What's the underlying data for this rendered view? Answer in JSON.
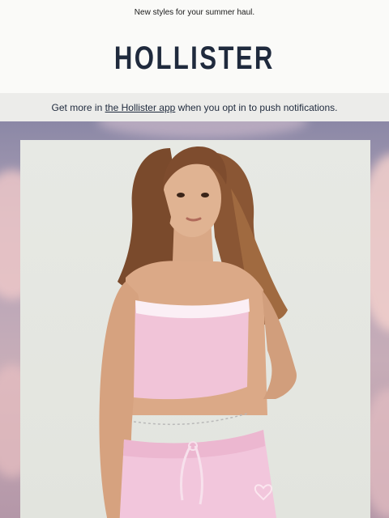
{
  "preheader": {
    "text": "New styles for your summer haul."
  },
  "brand": {
    "logo_text": "HOLLISTER"
  },
  "promo": {
    "prefix": "Get more in ",
    "link_text": "the Hollister app",
    "suffix": " when you opt in to push notifications."
  },
  "hero": {
    "image_icon": "model-photo-icon",
    "colors": {
      "top": "pink",
      "shorts": "pink"
    }
  }
}
